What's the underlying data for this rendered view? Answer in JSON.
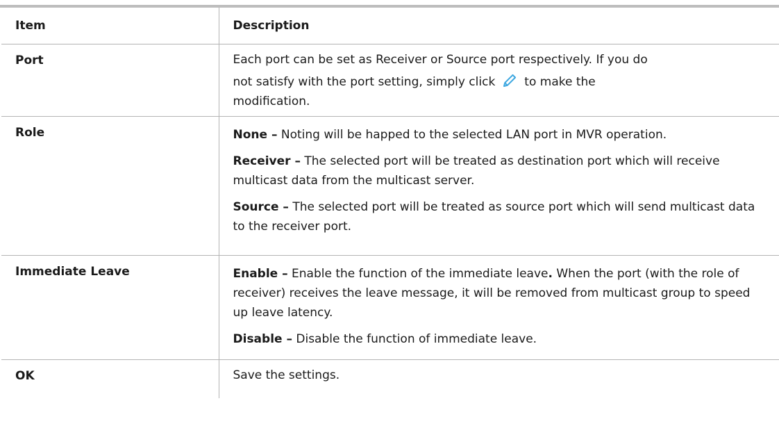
{
  "table": {
    "header": {
      "item": "Item",
      "description": "Description"
    },
    "rows": {
      "port": {
        "item": "Port",
        "line1": "Each port can be set as Receiver or Source port respectively. If you do",
        "line2_before": "not satisfy with the port setting, simply click",
        "line2_after": "to make the",
        "line3": "modification.",
        "icon": "pencil-edit-icon",
        "icon_color": "#3da7e0"
      },
      "role": {
        "item": "Role",
        "entries": [
          {
            "term": "None –",
            "text": " Noting will be happed to the selected LAN port in MVR operation."
          },
          {
            "term": "Receiver –",
            "text": " The selected port will be treated as destination port which will receive multicast data from the multicast server."
          },
          {
            "term": "Source –",
            "text": " The selected port will be treated as source port which will send multicast data to the receiver port."
          }
        ]
      },
      "immediate_leave": {
        "item": "Immediate Leave",
        "entries": [
          {
            "term": "Enable –",
            "text": " Enable the function of the immediate leave",
            "dot": ".",
            "text2": " When the port (with the role of receiver) receives the leave message, it will be removed from multicast group to speed up leave latency."
          },
          {
            "term": "Disable –",
            "text": " Disable the function of immediate leave."
          }
        ]
      },
      "ok": {
        "item": "OK",
        "description": "Save the settings."
      }
    }
  }
}
